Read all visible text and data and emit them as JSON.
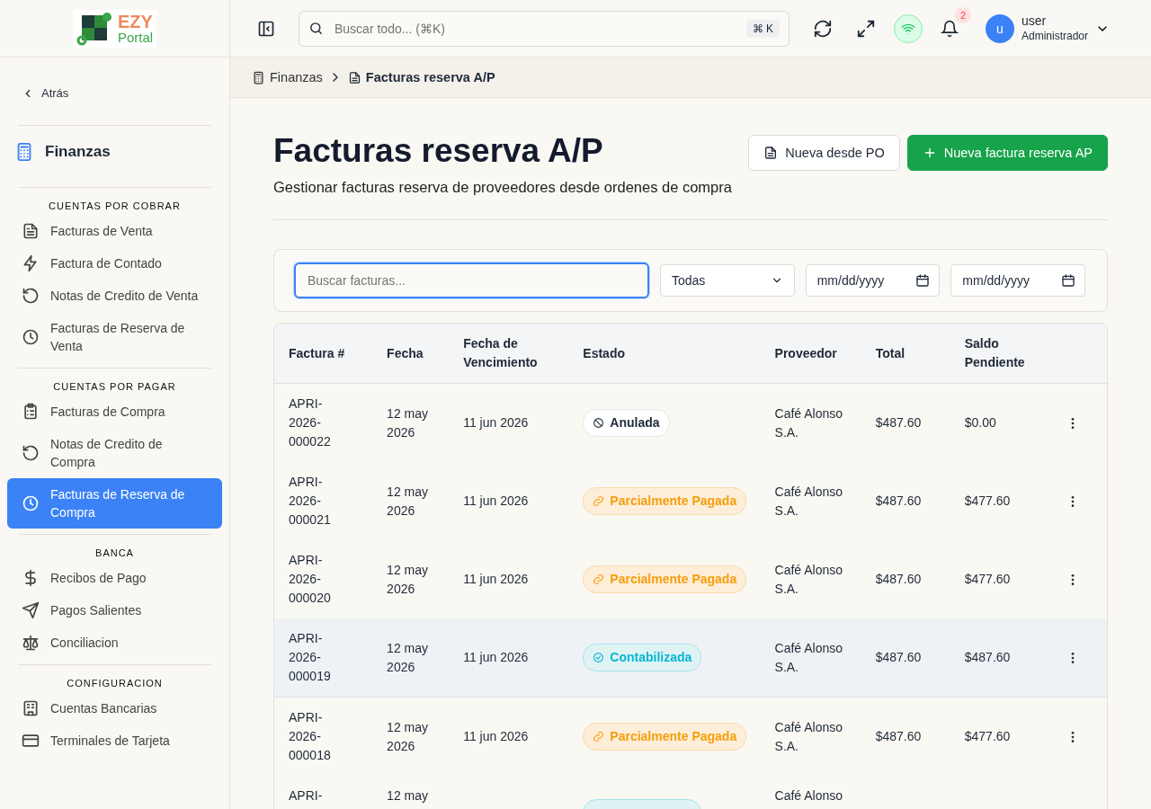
{
  "logo": {
    "word_top": "EZY",
    "word_bottom": "Portal"
  },
  "sidebar": {
    "back": "Atrás",
    "module": "Finanzas",
    "sections": [
      {
        "title": "CUENTAS POR COBRAR",
        "items": [
          {
            "label": "Facturas de Venta",
            "selected": false
          },
          {
            "label": "Factura de Contado",
            "selected": false
          },
          {
            "label": "Notas de Credito de Venta",
            "selected": false
          },
          {
            "label": "Facturas de Reserva de Venta",
            "selected": false
          }
        ]
      },
      {
        "title": "CUENTAS POR PAGAR",
        "items": [
          {
            "label": "Facturas de Compra",
            "selected": false
          },
          {
            "label": "Notas de Credito de Compra",
            "selected": false
          },
          {
            "label": "Facturas de Reserva de Compra",
            "selected": true
          }
        ]
      },
      {
        "title": "BANCA",
        "items": [
          {
            "label": "Recibos de Pago",
            "selected": false
          },
          {
            "label": "Pagos Salientes",
            "selected": false
          },
          {
            "label": "Conciliacion",
            "selected": false
          }
        ]
      },
      {
        "title": "CONFIGURACION",
        "items": [
          {
            "label": "Cuentas Bancarias",
            "selected": false
          },
          {
            "label": "Terminales de Tarjeta",
            "selected": false
          }
        ]
      }
    ]
  },
  "topbar": {
    "search_placeholder": "Buscar todo... (⌘K)",
    "shortcut": "⌘ K",
    "notifications": "2",
    "user": {
      "initial": "u",
      "name": "user",
      "role": "Administrador"
    }
  },
  "breadcrumb": [
    "Finanzas",
    "Facturas reserva A/P"
  ],
  "page": {
    "title": "Facturas reserva A/P",
    "subtitle": "Gestionar facturas reserva de proveedores desde ordenes de compra",
    "buttons": [
      {
        "label": "Nueva desde PO",
        "kind": "secondary"
      },
      {
        "label": "Nueva factura reserva AP",
        "kind": "primary"
      }
    ]
  },
  "filters": {
    "search": {
      "placeholder": "Buscar facturas...",
      "focused": true
    },
    "status": "Todas",
    "date_from": {
      "placeholder": "mm/dd/yyyy"
    },
    "date_to": {
      "placeholder": "mm/dd/yyyy"
    }
  },
  "table": {
    "columns": [
      "Factura #",
      "Fecha",
      "Fecha de Vencimiento",
      "Estado",
      "Proveedor",
      "Total",
      "Saldo Pendiente"
    ],
    "rows": [
      {
        "factura": "APRI-2026-000022",
        "fecha": "12 may 2026",
        "vencimiento": "11 jun 2026",
        "estado": {
          "label": "Anulada",
          "kind": "void"
        },
        "proveedor": "Café Alonso S.A.",
        "total": "$487.60",
        "saldo": "$0.00",
        "highlighted": false
      },
      {
        "factura": "APRI-2026-000021",
        "fecha": "12 may 2026",
        "vencimiento": "11 jun 2026",
        "estado": {
          "label": "Parcialmente Pagada",
          "kind": "partial"
        },
        "proveedor": "Café Alonso S.A.",
        "total": "$487.60",
        "saldo": "$477.60",
        "highlighted": false
      },
      {
        "factura": "APRI-2026-000020",
        "fecha": "12 may 2026",
        "vencimiento": "11 jun 2026",
        "estado": {
          "label": "Parcialmente Pagada",
          "kind": "partial"
        },
        "proveedor": "Café Alonso S.A.",
        "total": "$487.60",
        "saldo": "$477.60",
        "highlighted": false
      },
      {
        "factura": "APRI-2026-000019",
        "fecha": "12 may 2026",
        "vencimiento": "11 jun 2026",
        "estado": {
          "label": "Contabilizada",
          "kind": "posted"
        },
        "proveedor": "Café Alonso S.A.",
        "total": "$487.60",
        "saldo": "$487.60",
        "highlighted": true
      },
      {
        "factura": "APRI-2026-000018",
        "fecha": "12 may 2026",
        "vencimiento": "11 jun 2026",
        "estado": {
          "label": "Parcialmente Pagada",
          "kind": "partial"
        },
        "proveedor": "Café Alonso S.A.",
        "total": "$487.60",
        "saldo": "$477.60",
        "highlighted": false
      },
      {
        "factura": "APRI-",
        "fecha": "12 may",
        "estado": {
          "kind": "posted"
        },
        "proveedor": "Café Alonso",
        "highlighted": false
      }
    ]
  }
}
